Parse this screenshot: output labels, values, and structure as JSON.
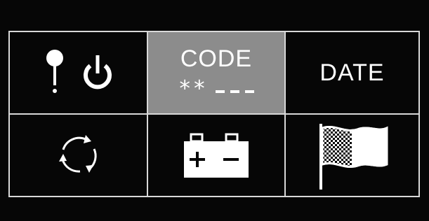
{
  "menu": {
    "code": {
      "title": "CODE",
      "value_masked": "**",
      "value_empty": "___"
    },
    "date": {
      "label": "DATE"
    }
  },
  "colors": {
    "background": "#060606",
    "grid_lines": "#d8d8d8",
    "selected_cell": "#8c8c8c",
    "foreground": "#ffffff"
  },
  "icons": {
    "pin": "pin-icon",
    "power": "power-icon",
    "refresh": "refresh-icon",
    "battery": "battery-icon",
    "flag": "checkered-flag-icon"
  }
}
